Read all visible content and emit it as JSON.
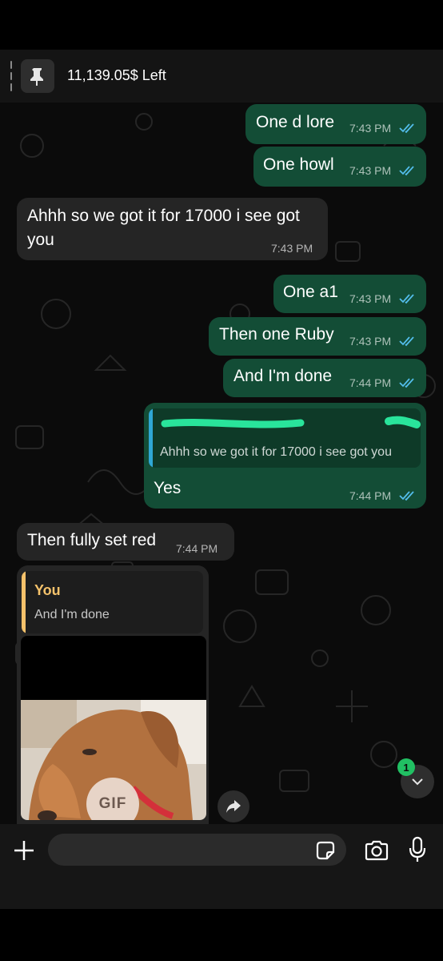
{
  "pinned": {
    "text": "11,139.05$ Left",
    "icon": "pin-icon"
  },
  "messages": [
    {
      "direction": "outgoing",
      "text": "One d lore",
      "time": "7:43 PM",
      "status": "read"
    },
    {
      "direction": "outgoing",
      "text": "One howl",
      "time": "7:43 PM",
      "status": "read"
    },
    {
      "direction": "incoming",
      "lines": [
        "Ahhh so we got it for 17000 i see got",
        "you"
      ],
      "time": "7:43 PM"
    },
    {
      "direction": "outgoing",
      "text": "One a1",
      "time": "7:43 PM",
      "status": "read"
    },
    {
      "direction": "outgoing",
      "text": "Then one Ruby",
      "time": "7:43 PM",
      "status": "read"
    },
    {
      "direction": "outgoing",
      "text": "And I'm done",
      "time": "7:44 PM",
      "status": "read"
    },
    {
      "direction": "outgoing",
      "reply_to": "Ahhh so we got it for 17000 i see got you",
      "text": "Yes",
      "time": "7:44 PM",
      "status": "read"
    },
    {
      "direction": "incoming",
      "text": "Then fully set red",
      "time": "7:44 PM"
    },
    {
      "direction": "incoming",
      "quote": {
        "author": "You",
        "text": "And I'm done"
      },
      "media": {
        "type": "gif",
        "label": "GIF"
      }
    }
  ],
  "unread_count": "1",
  "composer": {
    "placeholder": ""
  },
  "colors": {
    "outgoing": "#134d36",
    "incoming": "#252525",
    "read_ticks": "#53bdeb",
    "badge": "#21c063",
    "quote_author": "#f4c26b"
  },
  "icons": [
    "pin-icon",
    "double-check-icon",
    "forward-icon",
    "chevron-down-icon",
    "plus-icon",
    "sticker-icon",
    "camera-icon",
    "mic-icon"
  ]
}
